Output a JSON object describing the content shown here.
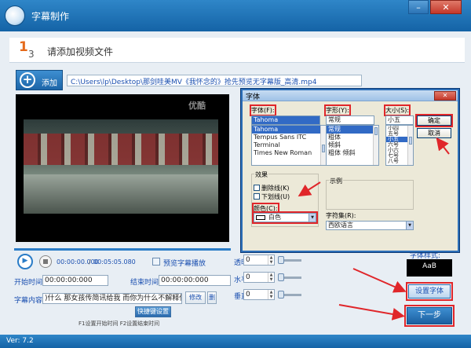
{
  "window": {
    "title": "字幕制作",
    "minimize_icon": "minimize-icon",
    "close_icon": "close-icon"
  },
  "step": {
    "number": "1",
    "total": "3",
    "title": "请添加视频文件"
  },
  "toolbar": {
    "add_label": "添加",
    "file_path": "C:\\Users\\lp\\Desktop\\那剑哇美MV《我怀念的》抢先预览无字幕版_高清.mp4"
  },
  "video": {
    "watermark": "优酷"
  },
  "playback": {
    "current_time": "00:00:00.000",
    "separator": "/",
    "total_time": "00:05:05.080",
    "preview_label": "预览字幕播放",
    "progress_percent": 100
  },
  "fields": {
    "start_label": "开始时间:",
    "start_value": "00:00:00:000",
    "end_label": "结束时间:",
    "end_value": "00:00:00:000",
    "content_label": "字幕内容:",
    "content_value": ")什么 那女孩传简讯给我 而你为什么不解释低着头沉",
    "modify_label": "修改",
    "delete_label": "删",
    "hotkey_label": "快捷键设置",
    "hint": "F1设置开始时间 F2设置结束时间"
  },
  "sliders": {
    "transparency_label": "透明度:",
    "transparency_value": "0",
    "hpos_label": "水平位置:",
    "hpos_value": "0",
    "vpos_label": "垂直位置:",
    "vpos_value": "0"
  },
  "right_panel": {
    "style_label": "字体样式:",
    "style_preview": "AaB",
    "set_font_label": "设置字体",
    "next_label": "下一步"
  },
  "footer": {
    "version": "Ver: 7.2"
  },
  "font_dialog": {
    "title": "字体",
    "close_label": "✕",
    "font_label": "字体(F):",
    "font_value": "Tahoma",
    "fonts": [
      "Tahoma",
      "Tempus Sans ITC",
      "Terminal",
      "Times New Roman"
    ],
    "style_label": "字形(Y):",
    "style_value": "常规",
    "styles": [
      "常规",
      "粗体",
      "倾斜",
      "粗体 倾斜"
    ],
    "size_label": "大小(S):",
    "size_value": "小五",
    "sizes": [
      "小四",
      "五号",
      "小五",
      "六号",
      "小六",
      "七号",
      "八号"
    ],
    "ok_label": "确定",
    "cancel_label": "取消",
    "effects_title": "效果",
    "strike_label": "删除线(K)",
    "underline_label": "下划线(U)",
    "color_label": "颜色(C):",
    "color_value": "白色",
    "sample_title": "示例",
    "charset_label": "字符集(R):",
    "charset_value": "西欧语言"
  },
  "colors": {
    "accent": "#1c65a8",
    "annotation": "#e0262a",
    "selection": "#316ac5"
  }
}
